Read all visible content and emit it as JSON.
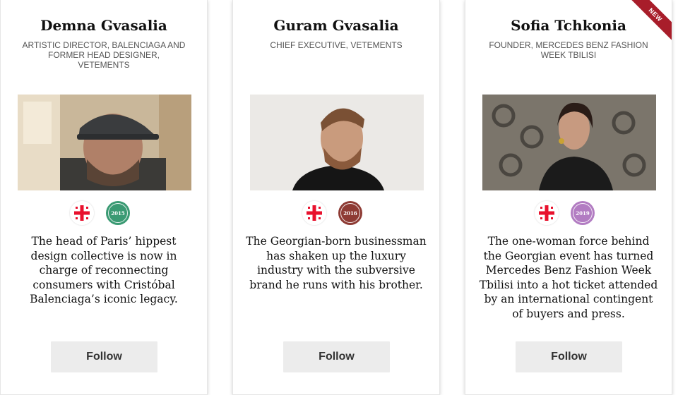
{
  "cards": [
    {
      "name": "Demna Gvasalia",
      "role": "Artistic Director, Balenciaga and Former Head Designer, Vetements",
      "year": "2015",
      "year_color": "#3a9a73",
      "description": "The head of Paris’ hippest design collective is now in charge of reconnecting consumers with Cristóbal Balenciaga’s iconic legacy.",
      "follow_label": "Follow",
      "photo_icon": "portrait-man-cap"
    },
    {
      "name": "Guram Gvasalia",
      "role": "Chief Executive, Vetements",
      "year": "2016",
      "year_color": "#8e3b34",
      "description": "The Georgian-born businessman has shaken up the luxury industry with the subversive brand he runs with his brother.",
      "follow_label": "Follow",
      "photo_icon": "portrait-man-beard"
    },
    {
      "name": "Sofia Tchkonia",
      "role": "Founder, Mercedes Benz Fashion Week Tbilisi",
      "year": "2019",
      "year_color": "#b27cc2",
      "description": "The one-woman force behind the Georgian event has turned Mercedes Benz Fashion Week Tbilisi into a hot ticket attended by an international contingent of buyers and press.",
      "follow_label": "Follow",
      "photo_icon": "portrait-woman",
      "badge": "NEW"
    }
  ],
  "flag_icon": "georgia-flag-icon",
  "colors": {
    "flag_red": "#e8112d",
    "ribbon": "#a81d2a",
    "button_bg": "#ececec"
  }
}
